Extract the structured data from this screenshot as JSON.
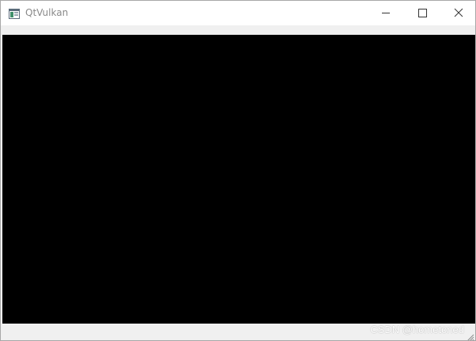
{
  "window": {
    "title": "QtVulkan",
    "accent": "#000000"
  },
  "titlebar": {
    "icon": "app-window-icon",
    "controls": {
      "minimize": "minimize-icon",
      "maximize": "maximize-icon",
      "close": "close-icon"
    }
  },
  "toolbar": {
    "handle_icon": "toolbar-grip-icon"
  },
  "viewport": {
    "background": "#000000"
  },
  "statusbar": {
    "watermark": "CSDN @hometoned",
    "grip_icon": "size-grip-icon"
  }
}
